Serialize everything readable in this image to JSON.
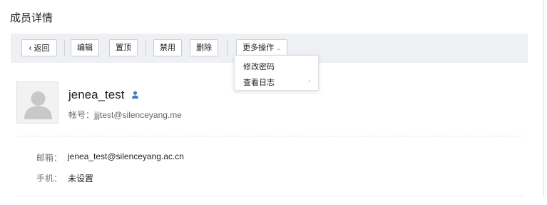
{
  "page": {
    "title": "成员详情"
  },
  "toolbar": {
    "back_label": "返回",
    "back_icon": "chevron-left-icon",
    "edit_label": "编辑",
    "pin_top_label": "置顶",
    "disable_label": "禁用",
    "delete_label": "删除",
    "more_label": "更多操作",
    "more_icon": "caret-down-icon"
  },
  "more_menu": {
    "items": [
      {
        "label": "修改密码",
        "has_submenu": false
      },
      {
        "label": "查看日志",
        "has_submenu": true
      }
    ]
  },
  "member": {
    "name": "jenea_test",
    "account_label": "帐号：",
    "account": "jjjtest@silenceyang.me",
    "role_icon": "user-icon",
    "avatar_icon": "default-avatar-icon"
  },
  "details": {
    "email_label": "邮箱：",
    "email": "jenea_test@silenceyang.ac.cn",
    "phone_label": "手机：",
    "phone": "未设置"
  },
  "colors": {
    "toolbar_bg": "#eef0f3",
    "role_icon": "#3f7cc0",
    "avatar_silhouette": "#c8c8c8"
  }
}
